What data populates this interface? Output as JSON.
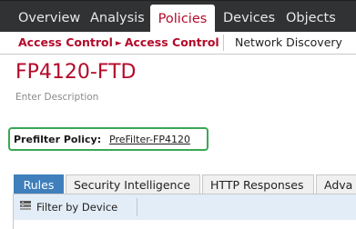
{
  "topnav": {
    "tabs": [
      {
        "label": "Overview"
      },
      {
        "label": "Analysis"
      },
      {
        "label": "Policies",
        "active": true
      },
      {
        "label": "Devices"
      },
      {
        "label": "Objects"
      }
    ]
  },
  "subnav": {
    "breadcrumb": [
      "Access Control",
      "Access Control"
    ],
    "other_link": "Network Discovery"
  },
  "policy": {
    "title": "FP4120-FTD",
    "description_placeholder": "Enter Description",
    "prefilter_label": "Prefilter Policy:",
    "prefilter_value": "PreFilter-FP4120"
  },
  "tabs": [
    {
      "label": "Rules",
      "active": true
    },
    {
      "label": "Security Intelligence"
    },
    {
      "label": "HTTP Responses"
    },
    {
      "label": "Adva"
    }
  ],
  "toolbar": {
    "filter_label": "Filter by Device",
    "filter_icon": "device-filter-icon"
  },
  "colors": {
    "accent_red": "#b40a2a",
    "nav_bg": "#313233",
    "active_tab_blue": "#3f7fbc",
    "highlight_green": "#3aa756"
  }
}
